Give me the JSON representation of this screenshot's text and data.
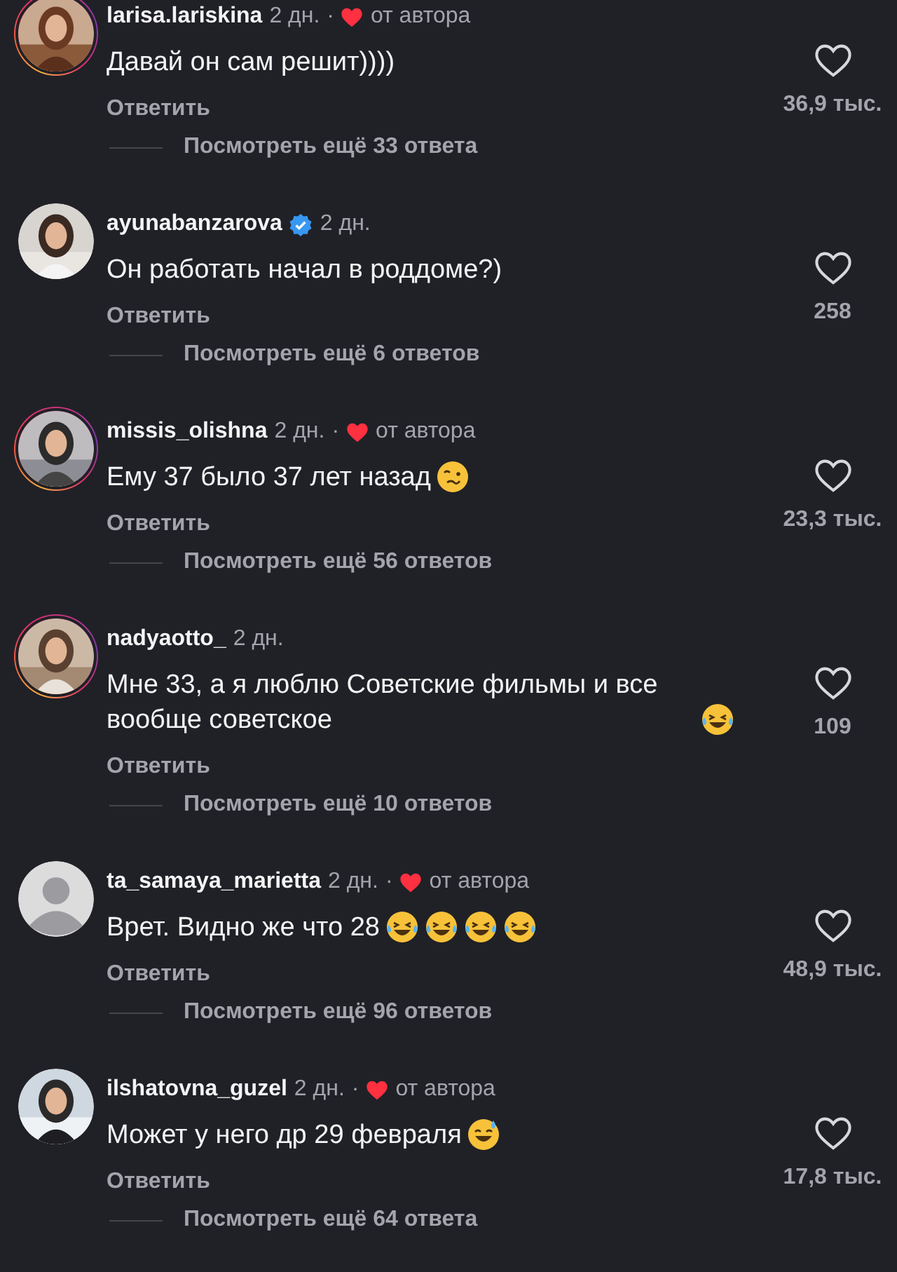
{
  "comments": [
    {
      "username": "larisa.lariskina",
      "verified": false,
      "time": "2 дн.",
      "author_liked": true,
      "separator": "·",
      "author_label": "от автора",
      "story": true,
      "text": "Давай он сам решит))))",
      "reply": "Ответить",
      "likes": "36,9 тыс.",
      "view_replies": "Посмотреть ещё 33 ответа"
    },
    {
      "username": "ayunabanzarova",
      "verified": true,
      "time": "2 дн.",
      "author_liked": false,
      "story": false,
      "text": "Он работать начал в роддоме?)",
      "reply": "Ответить",
      "likes": "258",
      "view_replies": "Посмотреть ещё 6 ответов"
    },
    {
      "username": "missis_olishna",
      "verified": false,
      "time": "2 дн.",
      "author_liked": true,
      "separator": "·",
      "author_label": "от автора",
      "story": true,
      "text": "Ему 37 было 37 лет назад",
      "emojis": [
        {
          "kind": "woozy"
        }
      ],
      "reply": "Ответить",
      "likes": "23,3 тыс.",
      "view_replies": "Посмотреть ещё 56 ответов"
    },
    {
      "username": "nadyaotto_",
      "verified": false,
      "time": "2 дн.",
      "author_liked": false,
      "story": true,
      "text": "Мне 33, а я люблю Советские фильмы и все вообще советское",
      "emojis": [
        {
          "kind": "laugh"
        }
      ],
      "reply": "Ответить",
      "likes": "109",
      "view_replies": "Посмотреть ещё 10 ответов"
    },
    {
      "username": "ta_samaya_marietta",
      "verified": false,
      "time": "2 дн.",
      "author_liked": true,
      "separator": "·",
      "author_label": "от автора",
      "story": false,
      "avatar": {
        "kind": "default"
      },
      "text": "Врет. Видно же что 28",
      "emojis": [
        {
          "kind": "laugh"
        },
        {
          "kind": "laugh"
        },
        {
          "kind": "laugh"
        },
        {
          "kind": "laugh"
        }
      ],
      "reply": "Ответить",
      "likes": "48,9 тыс.",
      "view_replies": "Посмотреть ещё 96 ответов"
    },
    {
      "username": "ilshatovna_guzel",
      "verified": false,
      "time": "2 дн.",
      "author_liked": true,
      "separator": "·",
      "author_label": "от автора",
      "story": false,
      "text": "Может у него др 29 февраля",
      "emojis": [
        {
          "kind": "sweat"
        }
      ],
      "reply": "Ответить",
      "likes": "17,8 тыс.",
      "view_replies": "Посмотреть ещё 64 ответа"
    }
  ]
}
